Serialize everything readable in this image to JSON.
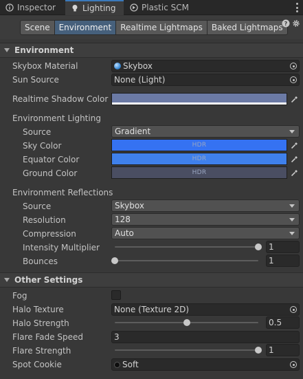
{
  "window_tabs": [
    {
      "label": "Inspector",
      "icon": "info-icon"
    },
    {
      "label": "Lighting",
      "icon": "lightbulb-icon"
    },
    {
      "label": "Plastic SCM",
      "icon": "plastic-scm-icon"
    }
  ],
  "toolbar": {
    "tabs": [
      "Scene",
      "Environment",
      "Realtime Lightmaps",
      "Baked Lightmaps"
    ],
    "active_tab": "Environment",
    "help_icon": "help-icon",
    "settings_icon": "gear-icon"
  },
  "environment": {
    "header": "Environment",
    "skybox_material": {
      "label": "Skybox Material",
      "value": "Skybox"
    },
    "sun_source": {
      "label": "Sun Source",
      "value": "None (Light)"
    },
    "realtime_shadow_color": {
      "label": "Realtime Shadow Color",
      "color": "#6b7aa5"
    },
    "lighting": {
      "header": "Environment Lighting",
      "source": {
        "label": "Source",
        "value": "Gradient"
      },
      "sky_color": {
        "label": "Sky Color",
        "color": "#3572f2",
        "hdr": "HDR"
      },
      "equator_color": {
        "label": "Equator Color",
        "color": "#3f80ec",
        "hdr": "HDR"
      },
      "ground_color": {
        "label": "Ground Color",
        "color": "#4a4e62",
        "hdr": "HDR"
      }
    },
    "reflections": {
      "header": "Environment Reflections",
      "source": {
        "label": "Source",
        "value": "Skybox"
      },
      "resolution": {
        "label": "Resolution",
        "value": "128"
      },
      "compression": {
        "label": "Compression",
        "value": "Auto"
      },
      "intensity_multiplier": {
        "label": "Intensity Multiplier",
        "value": "1",
        "fraction": 1.0
      },
      "bounces": {
        "label": "Bounces",
        "value": "1",
        "fraction": 0.0
      }
    }
  },
  "other_settings": {
    "header": "Other Settings",
    "fog": {
      "label": "Fog",
      "checked": false
    },
    "halo_texture": {
      "label": "Halo Texture",
      "value": "None (Texture 2D)"
    },
    "halo_strength": {
      "label": "Halo Strength",
      "value": "0.5",
      "fraction": 0.5
    },
    "flare_fade_speed": {
      "label": "Flare Fade Speed",
      "value": "3"
    },
    "flare_strength": {
      "label": "Flare Strength",
      "value": "1",
      "fraction": 1.0
    },
    "spot_cookie": {
      "label": "Spot Cookie",
      "value": "Soft"
    }
  }
}
